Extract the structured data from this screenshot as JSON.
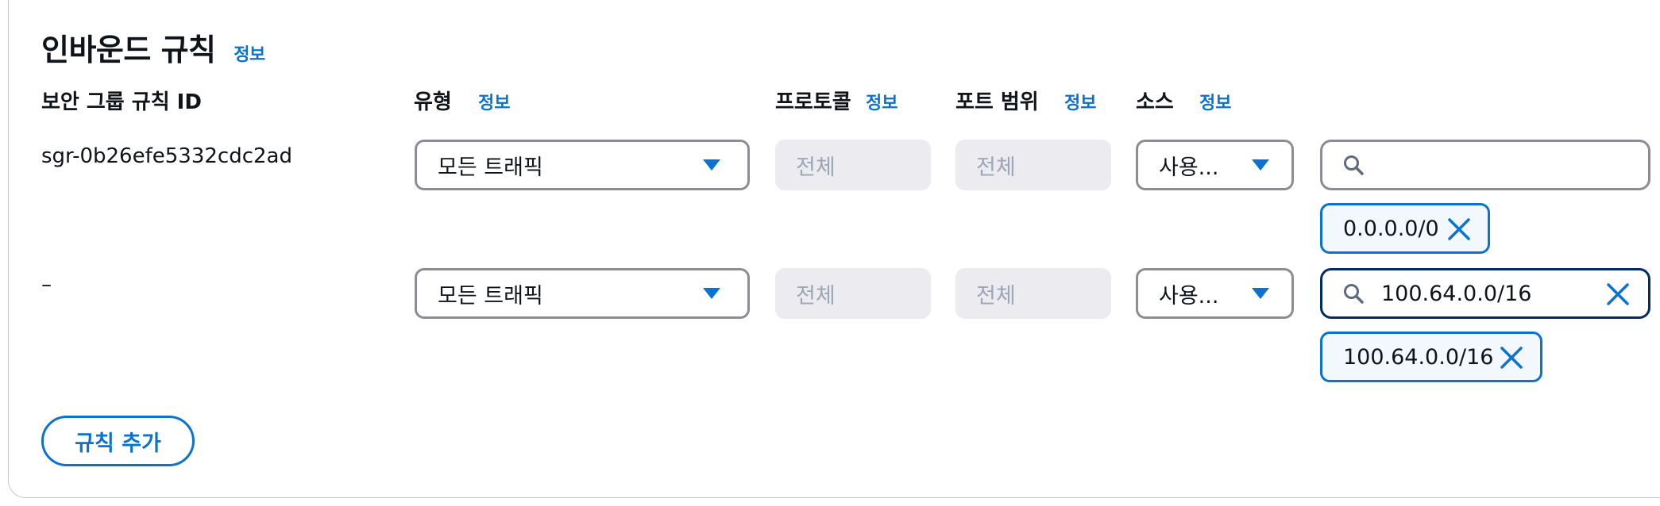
{
  "section": {
    "title": "인바운드 규칙",
    "info": "정보"
  },
  "columns": {
    "rule_id": "보안 그룹 규칙 ID",
    "type": "유형",
    "protocol": "프로토콜",
    "port_range": "포트 범위",
    "source": "소스",
    "info": "정보"
  },
  "rules": [
    {
      "id": "sgr-0b26efe5332cdc2ad",
      "type": "모든 트래픽",
      "protocol": "전체",
      "port_range": "전체",
      "source_type": "사용...",
      "search_value": "",
      "token": "0.0.0.0/0"
    },
    {
      "id": "–",
      "type": "모든 트래픽",
      "protocol": "전체",
      "port_range": "전체",
      "source_type": "사용...",
      "search_value": "100.64.0.0/16",
      "token": "100.64.0.0/16"
    }
  ],
  "add_rule_button": "규칙 추가",
  "icons": {
    "dropdown": "caret-down-icon",
    "search": "search-icon",
    "remove": "close-icon"
  },
  "colors": {
    "accent": "#0972d3",
    "focus_border": "#002b66",
    "disabled_bg": "#ebebf0"
  }
}
